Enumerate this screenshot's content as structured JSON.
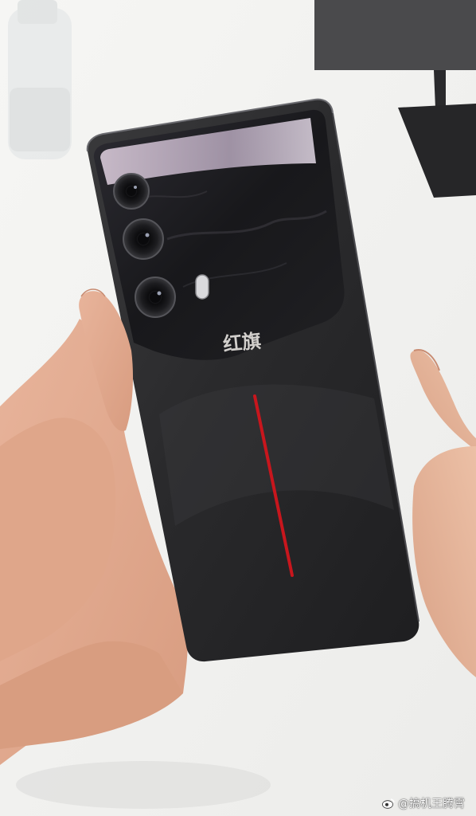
{
  "photo": {
    "subject": "phone-rear",
    "logo_text": "红旗",
    "accent_line_color": "#c8161d",
    "body_color": "#2b2b2d",
    "camera_count": 3
  },
  "watermark": {
    "handle": "@搞机王腾霄",
    "icon": "weibo-icon"
  }
}
